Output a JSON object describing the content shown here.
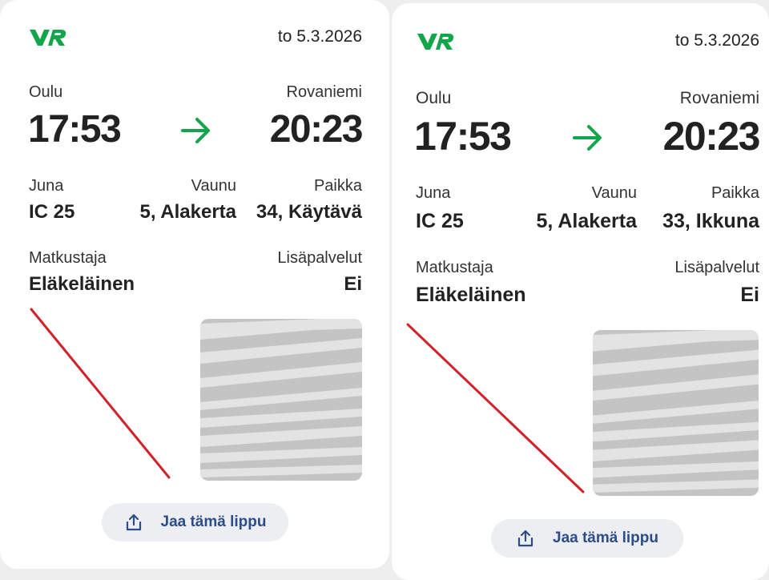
{
  "brand": {
    "logo_text": "VR",
    "accent": "#12a64a",
    "link_color": "#2c4c8a",
    "mark_color": "#d32128"
  },
  "tickets": [
    {
      "date": "to 5.3.2026",
      "from_station": "Oulu",
      "to_station": "Rovaniemi",
      "depart_time": "17:53",
      "arrive_time": "20:23",
      "train_label": "Juna",
      "train_value": "IC 25",
      "car_label": "Vaunu",
      "car_value": "5, Alakerta",
      "seat_label": "Paikka",
      "seat_value": "34, Käytävä",
      "passenger_label": "Matkustaja",
      "passenger_value": "Eläkeläinen",
      "extras_label": "Lisäpalvelut",
      "extras_value": "Ei",
      "share_label": "Jaa tämä lippu"
    },
    {
      "date": "to 5.3.2026",
      "from_station": "Oulu",
      "to_station": "Rovaniemi",
      "depart_time": "17:53",
      "arrive_time": "20:23",
      "train_label": "Juna",
      "train_value": "IC 25",
      "car_label": "Vaunu",
      "car_value": "5, Alakerta",
      "seat_label": "Paikka",
      "seat_value": "33, Ikkuna",
      "passenger_label": "Matkustaja",
      "passenger_value": "Eläkeläinen",
      "extras_label": "Lisäpalvelut",
      "extras_value": "Ei",
      "share_label": "Jaa tämä lippu"
    }
  ]
}
